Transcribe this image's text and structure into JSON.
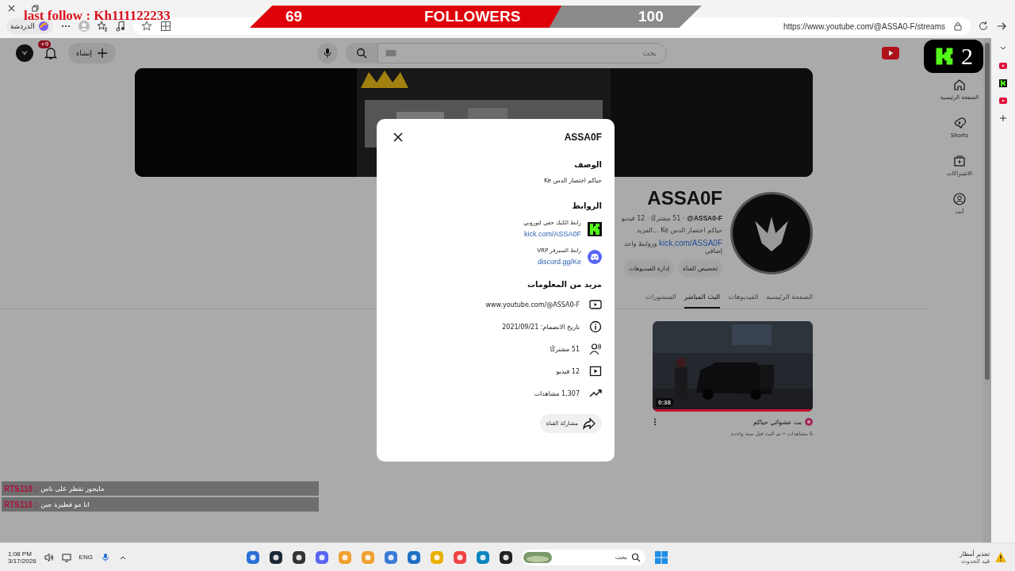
{
  "stream_overlay": {
    "last_follow": "last follow : Kh111122233",
    "followers_current": "69",
    "followers_label": "FOLLOWERS",
    "followers_goal": "100",
    "level": 0.69,
    "kick_badge": "2"
  },
  "browser": {
    "chat_button": "الدردشة",
    "url": "https://www.youtube.com/@ASSA0-F/streams"
  },
  "header": {
    "notification_count": "+9",
    "create_label": "إنشاء",
    "search_placeholder": "بحث"
  },
  "sidebar": [
    {
      "label": "الصفحة الرئيسية",
      "kind": "home"
    },
    {
      "label": "Shorts",
      "kind": "shorts"
    },
    {
      "label": "الاشتراكات",
      "kind": "subscriptions"
    },
    {
      "label": "أنت",
      "kind": "you"
    }
  ],
  "channel": {
    "name": "ASSA0F",
    "handle": "@ASSA0-F",
    "stats": "· 51 مشتركًا · 12 فيديو",
    "description": "حياكم اختصار الدس Ke ...المزيد",
    "link": "kick.com/ASSA0F",
    "extra_links": "وروابط واحد إضافي",
    "buttons": [
      "تخصيص القناة",
      "إدارة الفيديوهات"
    ]
  },
  "tabs": [
    {
      "label": "الصفحة الرئيسية",
      "selected": false
    },
    {
      "label": "الفيديوهات",
      "selected": false
    },
    {
      "label": "البث المباشر",
      "selected": true
    },
    {
      "label": "المنشورات",
      "selected": false
    }
  ],
  "videos": [
    {
      "duration": "0:38",
      "title": "بث عشوائي حياكم",
      "meta": "6 مشاهدات • تم البث قبل سنة واحدة"
    }
  ],
  "dialog": {
    "title": "ASSA0F",
    "description_heading": "الوصف",
    "description": "حياكم اختصار الدس Ke",
    "links_heading": "الروابط",
    "links": [
      {
        "kind": "kick",
        "title": "رابط الكيك حقي لتوروني",
        "url": "kick.com/ASSA0F"
      },
      {
        "kind": "discord",
        "title": "رابط السيرفر VRP",
        "url": "discord.gg/Ke"
      }
    ],
    "more_heading": "مزيد من المعلومات",
    "details": [
      {
        "kind": "channel",
        "text": "www.youtube.com/@ASSA0-F"
      },
      {
        "kind": "joined",
        "text": "تاريخ الانضمام: 2021/09/21"
      },
      {
        "kind": "subscribers",
        "text": "51 مشتركًا"
      },
      {
        "kind": "videos",
        "text": "12 فيديو"
      },
      {
        "kind": "views",
        "text": "1,307 مشاهدات"
      }
    ],
    "share_button": "مشاركة القناة"
  },
  "chat": [
    {
      "user": "RTS110 :",
      "message": "مايجوز تقطر على ناس"
    },
    {
      "user": "RTS110 :",
      "message": "انا مو فطيرة جبن"
    }
  ],
  "taskbar": {
    "time": "1:08 PM",
    "date": "3/17/2026",
    "language": "ENG",
    "search_placeholder": "بحث",
    "weather_title": "تحذير أمطار",
    "weather_status": "قيد الحدوث"
  }
}
